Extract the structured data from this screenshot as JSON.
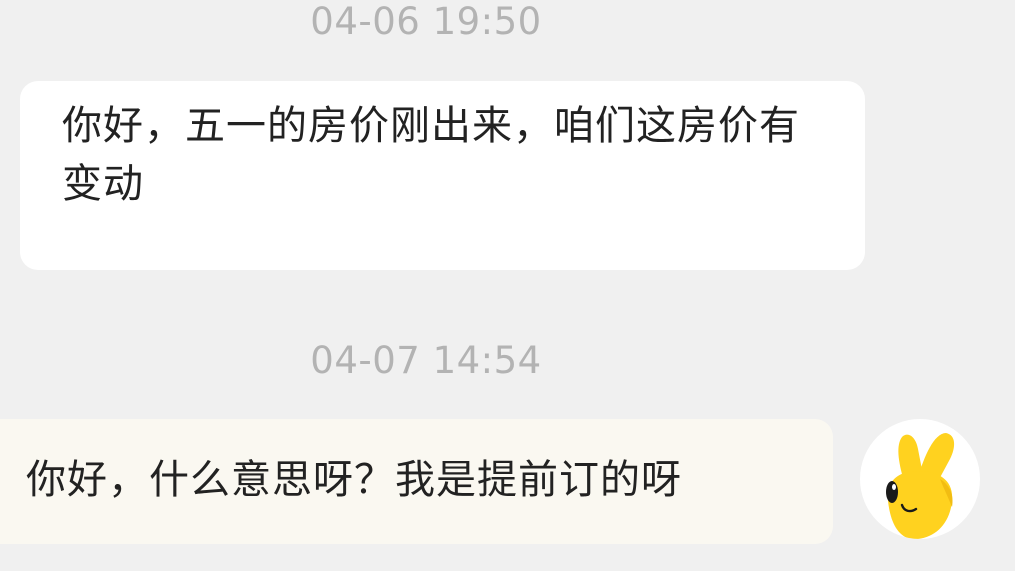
{
  "chat": {
    "messages": [
      {
        "timestamp": "04-06 19:50",
        "direction": "incoming",
        "text": "你好，五一的房价刚出来，咱们这房价有变动"
      },
      {
        "timestamp": "04-07 14:54",
        "direction": "outgoing",
        "text": "你好，什么意思呀？我是提前订的呀",
        "avatar": "yellow-hand-mascot-icon"
      }
    ]
  },
  "colors": {
    "background": "#f0f0f0",
    "incoming_bubble": "#ffffff",
    "outgoing_bubble": "#faf8f1",
    "timestamp_text": "#b3b3b3",
    "message_text": "#222222",
    "avatar_yellow": "#ffd21f"
  }
}
